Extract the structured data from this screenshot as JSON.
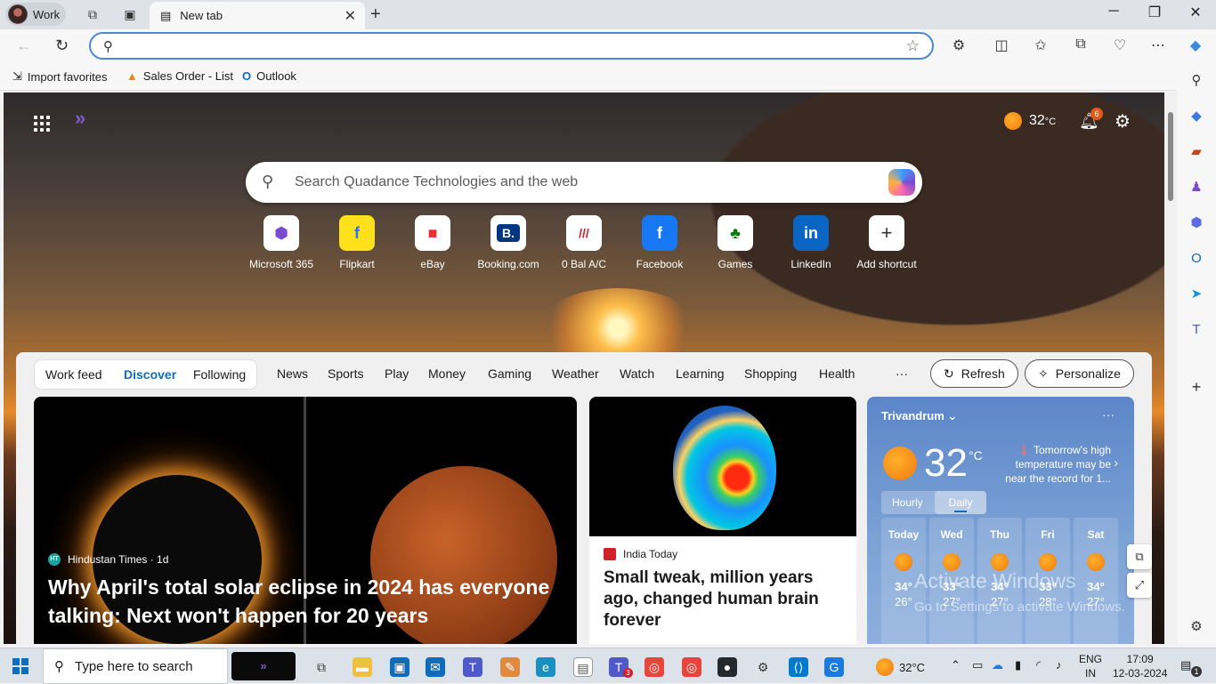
{
  "browser": {
    "profile": "Work",
    "tab_title": "New tab",
    "address_value": "",
    "favorites": [
      "Import favorites",
      "Sales Order - List",
      "Outlook"
    ]
  },
  "newtab": {
    "weather_temp": "32",
    "weather_unit": "°C",
    "notifications_count": "6",
    "search_placeholder": "Search Quadance Technologies and the web",
    "shortcuts": [
      "Microsoft 365",
      "Flipkart",
      "eBay",
      "Booking.com",
      "0 Bal A/C",
      "Facebook",
      "Games",
      "LinkedIn",
      "Add shortcut"
    ]
  },
  "feed": {
    "pills": [
      "Work feed",
      "Discover",
      "Following"
    ],
    "tabs": [
      "News",
      "Sports",
      "Play",
      "Money",
      "Gaming",
      "Weather",
      "Watch",
      "Learning",
      "Shopping",
      "Health"
    ],
    "more": "···",
    "refresh_label": "Refresh",
    "personalize_label": "Personalize",
    "hero": {
      "source": "Hindustan Times · 1d",
      "source_logo": "HT",
      "title": "Why April's total solar eclipse in 2024 has everyone talking: Next won't happen for 20 years"
    },
    "mid": {
      "source": "India Today",
      "title": "Small tweak, million years ago, changed human brain forever"
    }
  },
  "weather": {
    "location": "Trivandrum",
    "temp": "32",
    "unit": "°C",
    "note": "Tomorrow's high temperature may be near the record for 1...",
    "hourly": "Hourly",
    "daily": "Daily",
    "days": [
      {
        "name": "Today",
        "hi": "34°",
        "lo": "26°"
      },
      {
        "name": "Wed",
        "hi": "33°",
        "lo": "27°"
      },
      {
        "name": "Thu",
        "hi": "34°",
        "lo": "27°"
      },
      {
        "name": "Fri",
        "hi": "33°",
        "lo": "28°"
      },
      {
        "name": "Sat",
        "hi": "34°",
        "lo": "27°"
      }
    ]
  },
  "watermark": {
    "line1": "Activate Windows",
    "line2": "Go to Settings to activate Windows."
  },
  "taskbar": {
    "search_placeholder": "Type here to search",
    "weather": "32°C",
    "lang": "ENG",
    "region": "IN",
    "time": "17:09",
    "date": "12-03-2024",
    "notif_count": "1",
    "teams_badge": "3"
  }
}
